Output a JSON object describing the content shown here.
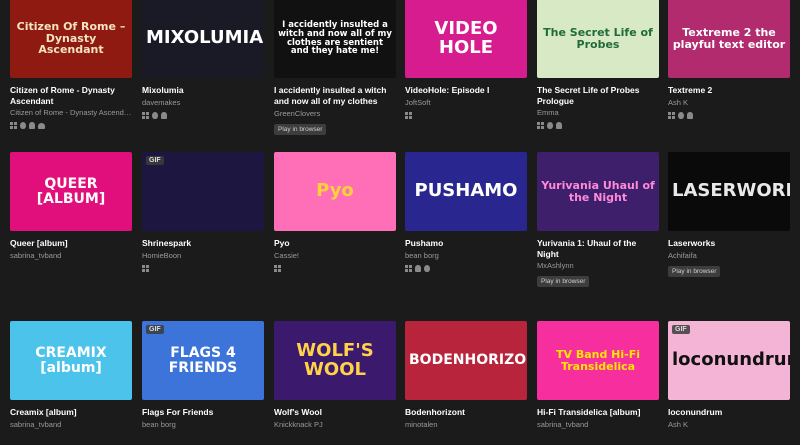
{
  "games": [
    {
      "title": "Citizen of Rome - Dynasty Ascendant",
      "author": "Citizen of Rome - Dynasty Ascenda...",
      "thumb_text": "Citizen Of Rome – Dynasty Ascendant",
      "bg": "#8e1a12",
      "fg": "#f4e4c1",
      "platforms": [
        "win",
        "mac",
        "lin",
        "and"
      ],
      "play": "",
      "gif": false
    },
    {
      "title": "Mixolumia",
      "author": "davemakes",
      "thumb_text": "MIXOLUMIA",
      "bg": "#1a1a26",
      "fg": "#ffffff",
      "platforms": [
        "win",
        "mac",
        "lin"
      ],
      "play": "",
      "gif": false
    },
    {
      "title": "I accidently insulted a witch and now all of my clothes are...",
      "author": "GreenClovers",
      "thumb_text": "I accidently insulted a witch and now all of my clothes are sentient and they hate me!",
      "bg": "#111111",
      "fg": "#ffffff",
      "platforms": [],
      "play": "Play in browser",
      "gif": false
    },
    {
      "title": "VideoHole: Episode I",
      "author": "JoftSoft",
      "thumb_text": "VIDEO HOLE",
      "bg": "#d61c8f",
      "fg": "#ffffff",
      "platforms": [
        "win"
      ],
      "play": "",
      "gif": false
    },
    {
      "title": "The Secret Life of Probes Prologue",
      "author": "Emma",
      "thumb_text": "The Secret Life of Probes",
      "bg": "#d8e9c6",
      "fg": "#1f6b3a",
      "platforms": [
        "win",
        "mac",
        "lin"
      ],
      "play": "",
      "gif": false
    },
    {
      "title": "Textreme 2",
      "author": "Ash K",
      "thumb_text": "Textreme 2 the playful text editor",
      "bg": "#b22b6e",
      "fg": "#ffffff",
      "platforms": [
        "win",
        "mac",
        "lin"
      ],
      "play": "",
      "gif": false
    },
    {
      "title": "Queer [album]",
      "author": "sabrina_tvband",
      "thumb_text": "QUEER [ALBUM]",
      "bg": "#e10f7b",
      "fg": "#ffffff",
      "platforms": [],
      "play": "",
      "gif": false
    },
    {
      "title": "Shrinespark",
      "author": "HomieBoon",
      "thumb_text": "",
      "bg": "#1c1640",
      "fg": "#ffffff",
      "platforms": [
        "win"
      ],
      "play": "",
      "gif": true
    },
    {
      "title": "Pyo",
      "author": "Cassie!",
      "thumb_text": "Pyo",
      "bg": "#ff6fb7",
      "fg": "#ffd23a",
      "platforms": [
        "win"
      ],
      "play": "",
      "gif": false
    },
    {
      "title": "Pushamo",
      "author": "bean borg",
      "thumb_text": "PUSHAMO",
      "bg": "#2a2690",
      "fg": "#ffffff",
      "platforms": [
        "win",
        "lin",
        "mac"
      ],
      "play": "",
      "gif": false
    },
    {
      "title": "Yurivania 1: Uhaul of the Night",
      "author": "MxAshlynn",
      "thumb_text": "Yurivania Uhaul of the Night",
      "bg": "#3e1f6b",
      "fg": "#ff8ad8",
      "platforms": [],
      "play": "Play in browser",
      "gif": false
    },
    {
      "title": "Laserworks",
      "author": "Achifaifa",
      "thumb_text": "LASERWORKS",
      "bg": "#0a0a0a",
      "fg": "#e9e9e9",
      "platforms": [],
      "play": "Play in browser",
      "gif": false
    },
    {
      "title": "Creamix [album]",
      "author": "sabrina_tvband",
      "thumb_text": "CREAMIX [album]",
      "bg": "#4cc3ea",
      "fg": "#ffffff",
      "platforms": [],
      "play": "",
      "gif": false
    },
    {
      "title": "Flags For Friends",
      "author": "bean borg",
      "thumb_text": "FLAGS 4 FRIENDS",
      "bg": "#3c74d9",
      "fg": "#ffffff",
      "platforms": [],
      "play": "",
      "gif": true
    },
    {
      "title": "Wolf's Wool",
      "author": "Knickknack PJ",
      "thumb_text": "WOLF'S WOOL",
      "bg": "#3b1a6e",
      "fg": "#ffd24a",
      "platforms": [],
      "play": "",
      "gif": false
    },
    {
      "title": "Bodenhorizont",
      "author": "minotalen",
      "thumb_text": "BODENHORIZONT",
      "bg": "#b8243c",
      "fg": "#ffffff",
      "platforms": [],
      "play": "",
      "gif": false
    },
    {
      "title": "Hi-Fi Transidelica [album]",
      "author": "sabrina_tvband",
      "thumb_text": "TV Band Hi-Fi Transidelica",
      "bg": "#f72f9e",
      "fg": "#ffe600",
      "platforms": [],
      "play": "",
      "gif": false
    },
    {
      "title": "loconundrum",
      "author": "Ash K",
      "thumb_text": "loconundrum",
      "bg": "#f4b4d6",
      "fg": "#111111",
      "platforms": [],
      "play": "",
      "gif": true
    }
  ],
  "gif_label": "GIF",
  "platform_icons": {
    "win": "windows-icon",
    "mac": "apple-icon",
    "lin": "linux-icon",
    "and": "android-icon"
  }
}
